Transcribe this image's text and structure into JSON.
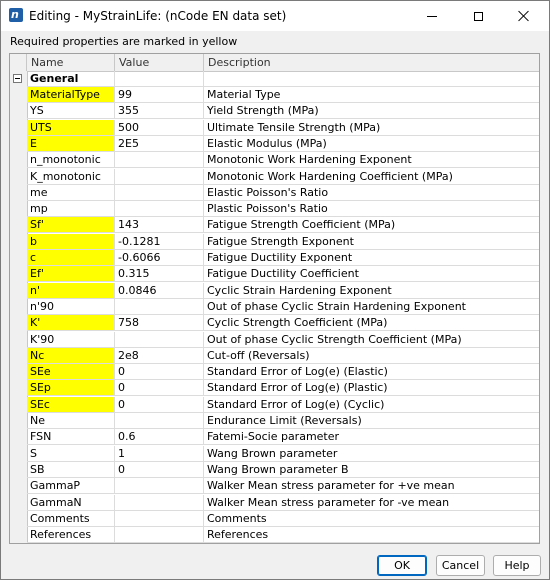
{
  "window": {
    "title": "Editing - MyStrainLife: (nCode EN data set)",
    "app_icon_letter": "n"
  },
  "hint": "Required properties are marked in  yellow",
  "columns": [
    "Name",
    "Value",
    "Description"
  ],
  "group": {
    "name": "General",
    "expanded": true
  },
  "rows": [
    {
      "name": "MaterialType",
      "value": "99",
      "description": "Material Type",
      "required": true
    },
    {
      "name": "YS",
      "value": "355",
      "description": "Yield Strength (MPa)",
      "required": false
    },
    {
      "name": "UTS",
      "value": "500",
      "description": "Ultimate Tensile Strength (MPa)",
      "required": true
    },
    {
      "name": "E",
      "value": "2E5",
      "description": "Elastic Modulus (MPa)",
      "required": true
    },
    {
      "name": "n_monotonic",
      "value": "",
      "description": "Monotonic Work Hardening Exponent",
      "required": false
    },
    {
      "name": "K_monotonic",
      "value": "",
      "description": "Monotonic Work Hardening Coefficient (MPa)",
      "required": false
    },
    {
      "name": "me",
      "value": "",
      "description": "Elastic Poisson's Ratio",
      "required": false
    },
    {
      "name": "mp",
      "value": "",
      "description": "Plastic Poisson's Ratio",
      "required": false
    },
    {
      "name": "Sf'",
      "value": "143",
      "description": "Fatigue Strength Coefficient (MPa)",
      "required": true
    },
    {
      "name": "b",
      "value": "-0.1281",
      "description": "Fatigue Strength Exponent",
      "required": true
    },
    {
      "name": "c",
      "value": "-0.6066",
      "description": "Fatigue Ductility Exponent",
      "required": true
    },
    {
      "name": "Ef'",
      "value": "0.315",
      "description": "Fatigue Ductility Coefficient",
      "required": true
    },
    {
      "name": "n'",
      "value": "0.0846",
      "description": "Cyclic Strain Hardening Exponent",
      "required": true
    },
    {
      "name": "n'90",
      "value": "",
      "description": "Out of phase Cyclic Strain Hardening Exponent",
      "required": false
    },
    {
      "name": "K'",
      "value": "758",
      "description": "Cyclic Strength Coefficient (MPa)",
      "required": true
    },
    {
      "name": "K'90",
      "value": "",
      "description": "Out of phase Cyclic Strength Coefficient (MPa)",
      "required": false
    },
    {
      "name": "Nc",
      "value": "2e8",
      "description": "Cut-off (Reversals)",
      "required": true
    },
    {
      "name": "SEe",
      "value": "0",
      "description": "Standard Error of Log(e) (Elastic)",
      "required": true
    },
    {
      "name": "SEp",
      "value": "0",
      "description": "Standard Error of Log(e) (Plastic)",
      "required": true
    },
    {
      "name": "SEc",
      "value": "0",
      "description": "Standard Error of Log(e) (Cyclic)",
      "required": true
    },
    {
      "name": "Ne",
      "value": "",
      "description": "Endurance Limit (Reversals)",
      "required": false
    },
    {
      "name": "FSN",
      "value": "0.6",
      "description": "Fatemi-Socie parameter",
      "required": false
    },
    {
      "name": "S",
      "value": "1",
      "description": "Wang Brown parameter",
      "required": false
    },
    {
      "name": "SB",
      "value": "0",
      "description": "Wang Brown parameter B",
      "required": false
    },
    {
      "name": "GammaP",
      "value": "",
      "description": "Walker Mean stress parameter for +ve mean",
      "required": false
    },
    {
      "name": "GammaN",
      "value": "",
      "description": "Walker Mean stress parameter for -ve mean",
      "required": false
    },
    {
      "name": "Comments",
      "value": "",
      "description": "Comments",
      "required": false
    },
    {
      "name": "References",
      "value": "",
      "description": "References",
      "required": false
    }
  ],
  "buttons": {
    "ok": "OK",
    "cancel": "Cancel",
    "help": "Help"
  },
  "colors": {
    "required_highlight": "#ffff00",
    "default_button_border": "#0067c0"
  }
}
